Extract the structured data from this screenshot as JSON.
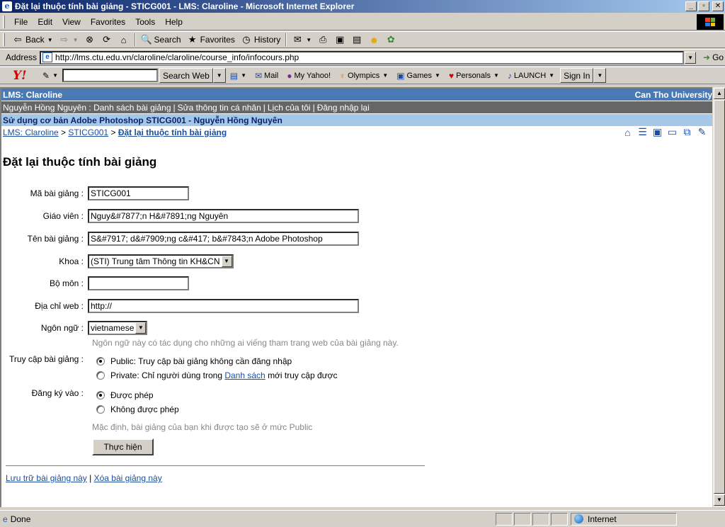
{
  "window": {
    "title": "Đặt lại thuộc tính bài giảng - STICG001 - LMS: Claroline - Microsoft Internet Explorer",
    "minimize": "_",
    "maximize": "▫",
    "close": "✕"
  },
  "menu": [
    "File",
    "Edit",
    "View",
    "Favorites",
    "Tools",
    "Help"
  ],
  "toolbar": {
    "back": "Back",
    "search": "Search",
    "favorites": "Favorites",
    "history": "History"
  },
  "address": {
    "label": "Address",
    "url": "http://lms.ctu.edu.vn/claroline/claroline/course_info/infocours.php",
    "go": "Go"
  },
  "yahoo": {
    "search_web": "Search Web",
    "mail": "Mail",
    "my_yahoo": "My Yahoo!",
    "olympics": "Olympics",
    "games": "Games",
    "personals": "Personals",
    "launch": "LAUNCH",
    "sign_in": "Sign In"
  },
  "site": {
    "name": "LMS: Claroline",
    "university": "Can Tho University",
    "user_bar": [
      "Nguyễn Hồng Nguyên : Danh sách bài giảng",
      "Sửa thông tin cá nhân",
      "Lịch của tôi",
      "Đăng nhập lại"
    ],
    "course_title": "Sử dụng cơ bản Adobe Photoshop STICG001 - Nguyễn Hồng Nguyên",
    "breadcrumb": {
      "home": "LMS: Claroline",
      "sep1": ">",
      "course": "STICG001",
      "sep2": ">",
      "current": "Đặt lại thuộc tính bài giảng"
    }
  },
  "page": {
    "title": "Đặt lại thuộc tính bài giảng",
    "fields": {
      "code_label": "Mã bài giảng :",
      "code_value": "STICG001",
      "teacher_label": "Giáo viên :",
      "teacher_value": "Nguy&#7877;n H&#7891;ng Nguyên",
      "name_label": "Tên bài giảng :",
      "name_value": "S&#7917; d&#7909;ng c&#417; b&#7843;n Adobe Photoshop",
      "faculty_label": "Khoa :",
      "faculty_value": "(STI) Trung tâm Thông tin KH&CN",
      "dept_label": "Bộ môn :",
      "dept_value": "",
      "web_label": "Địa chỉ web :",
      "web_value": "http://",
      "lang_label": "Ngôn ngữ :",
      "lang_value": "vietnamese",
      "lang_hint": "Ngôn ngữ này có tác dụng cho những ai viếng tham trang web của bài giảng này.",
      "access_label": "Truy cập bài giảng :",
      "access_public": "Public: Truy cập bài giảng không cần đăng nhập",
      "access_private_pre": "Private: Chỉ người dùng trong",
      "access_private_link": "Danh sách",
      "access_private_post": "mới truy cập được",
      "enroll_label": "Đăng ký vào :",
      "enroll_allowed": "Được phép",
      "enroll_denied": "Không được phép",
      "default_hint": "Mặc định, bài giảng của bạn khi được tạo sẽ ở mức Public"
    },
    "submit": "Thực hiện",
    "footer": {
      "archive": "Lưu trữ bài giảng này",
      "sep": "|",
      "delete": "Xóa bài giảng này"
    }
  },
  "status": {
    "text": "Done",
    "zone": "Internet"
  }
}
